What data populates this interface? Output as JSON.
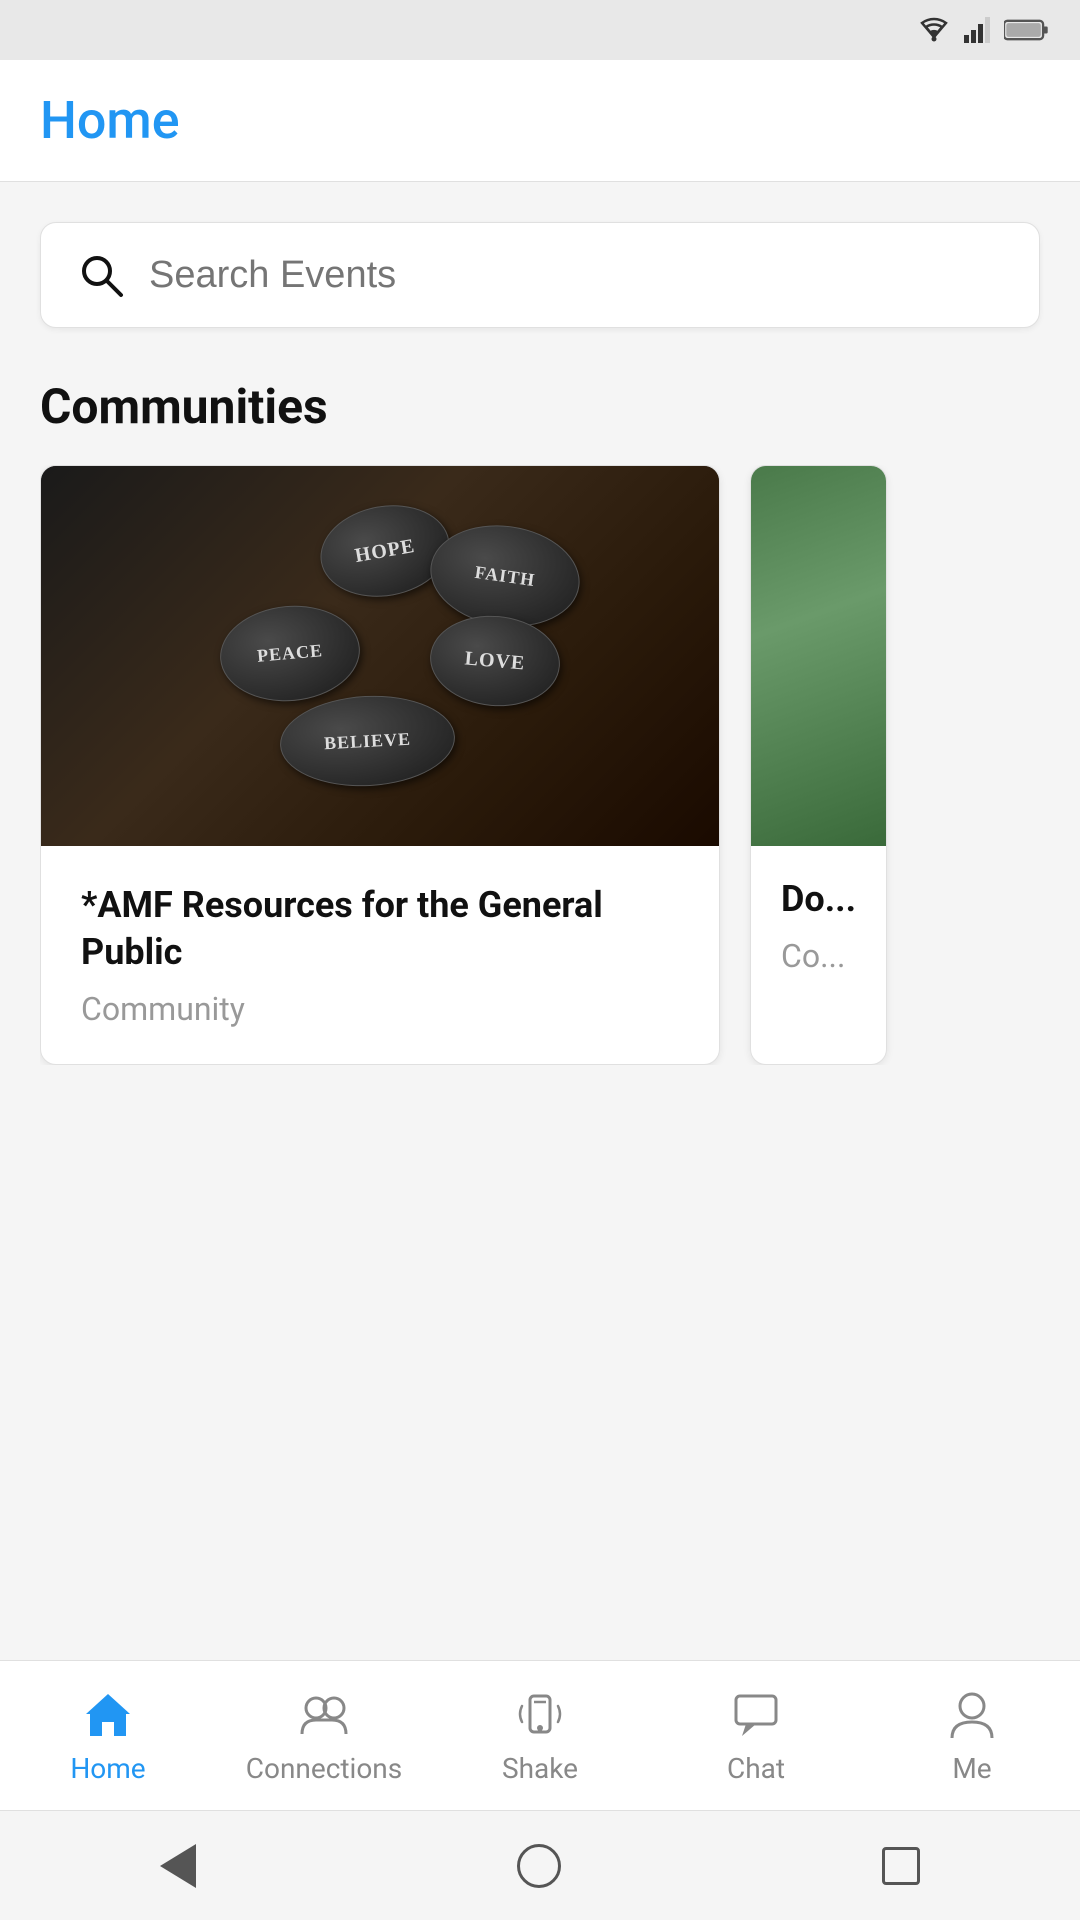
{
  "statusBar": {
    "wifi": "wifi",
    "signal": "signal",
    "battery": "battery"
  },
  "header": {
    "title": "Home"
  },
  "search": {
    "placeholder": "Search Events"
  },
  "sections": {
    "communities": {
      "label": "Communities",
      "cards": [
        {
          "id": "card-1",
          "name": "*AMF Resources for the General Public",
          "type": "Community",
          "stones": [
            "HOPE",
            "FAITH",
            "PEACE",
            "LOVE",
            "BELIEVE"
          ]
        },
        {
          "id": "card-2",
          "name": "Do...",
          "type": "Co..."
        }
      ]
    }
  },
  "bottomNav": {
    "items": [
      {
        "id": "home",
        "label": "Home",
        "active": true
      },
      {
        "id": "connections",
        "label": "Connections",
        "active": false
      },
      {
        "id": "shake",
        "label": "Shake",
        "active": false
      },
      {
        "id": "chat",
        "label": "Chat",
        "active": false
      },
      {
        "id": "me",
        "label": "Me",
        "active": false
      }
    ]
  }
}
